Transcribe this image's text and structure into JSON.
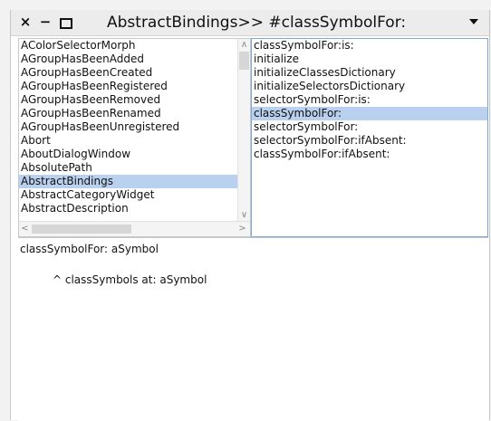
{
  "window": {
    "title": "AbstractBindings>> #classSymbolFor:",
    "controls": {
      "close": "×",
      "minimize": "−"
    }
  },
  "classes": {
    "items": [
      "AColorSelectorMorph",
      "AGroupHasBeenAdded",
      "AGroupHasBeenCreated",
      "AGroupHasBeenRegistered",
      "AGroupHasBeenRemoved",
      "AGroupHasBeenRenamed",
      "AGroupHasBeenUnregistered",
      "Abort",
      "AboutDialogWindow",
      "AbsolutePath",
      "AbstractBindings",
      "AbstractCategoryWidget",
      "AbstractDescription"
    ],
    "selected": "AbstractBindings"
  },
  "methods": {
    "items": [
      "classSymbolFor:is:",
      "initialize",
      "initializeClassesDictionary",
      "initializeSelectorsDictionary",
      "selectorSymbolFor:is:",
      "classSymbolFor:",
      "selectorSymbolFor:",
      "selectorSymbolFor:ifAbsent:",
      "classSymbolFor:ifAbsent:"
    ],
    "selected": "classSymbolFor:"
  },
  "code": {
    "signature": "classSymbolFor: aSymbol",
    "body": "^ classSymbols at: aSymbol"
  },
  "scrollbars": {
    "up": "∧",
    "down": "∨",
    "left": "<",
    "right": ">"
  }
}
